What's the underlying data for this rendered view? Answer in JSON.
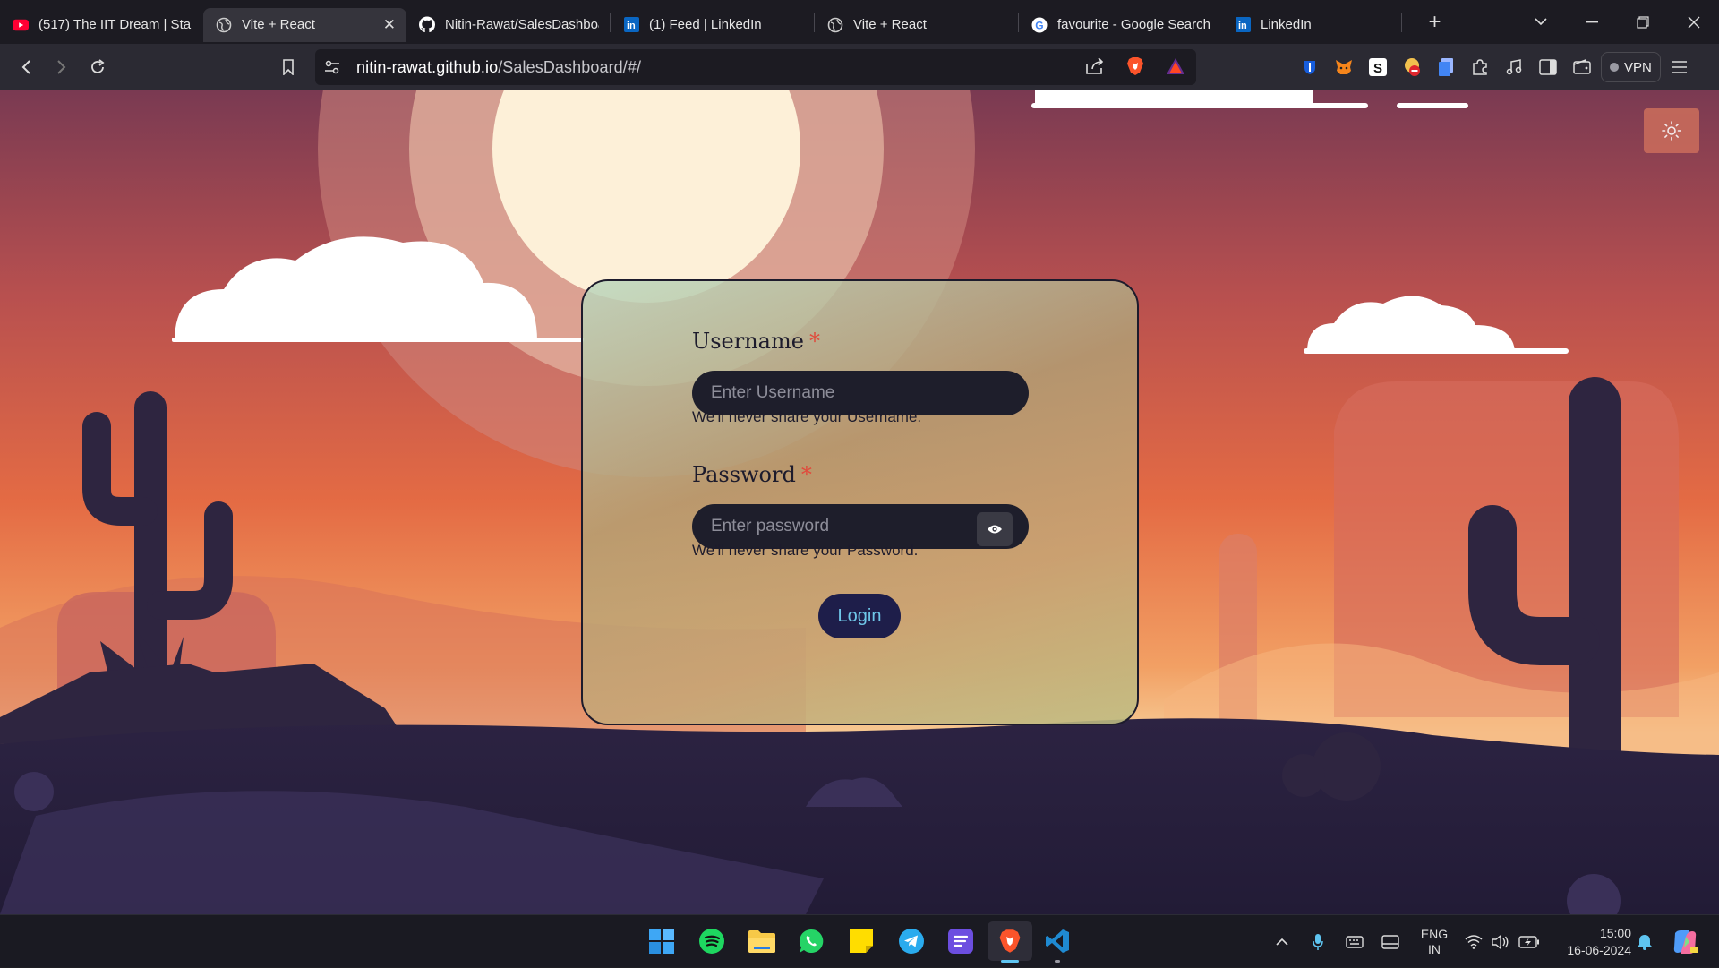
{
  "browser": {
    "tabs": [
      {
        "title": "(517) The IIT Dream | Stan",
        "favicon": "youtube-icon",
        "active": false
      },
      {
        "title": "Vite + React",
        "favicon": "globe-icon",
        "active": true
      },
      {
        "title": "Nitin-Rawat/SalesDashboa",
        "favicon": "github-icon",
        "active": false
      },
      {
        "title": "(1) Feed | LinkedIn",
        "favicon": "linkedin-icon",
        "active": false
      },
      {
        "title": "Vite + React",
        "favicon": "globe-icon",
        "active": false
      },
      {
        "title": "favourite - Google Search",
        "favicon": "google-icon",
        "active": false
      },
      {
        "title": "LinkedIn",
        "favicon": "linkedin-icon",
        "active": false
      }
    ],
    "close_glyph": "✕",
    "new_tab_glyph": "+",
    "url_host": "nitin-rawat.github.io",
    "url_path": "/SalesDashboard/#/",
    "vpn_label": "VPN"
  },
  "login": {
    "username_label": "Username",
    "username_required": "*",
    "username_placeholder": "Enter Username",
    "username_help": "We'll never share your Username.",
    "password_label": "Password",
    "password_required": "*",
    "password_placeholder": "Enter password",
    "password_help": "We'll never share your Password.",
    "login_label": "Login"
  },
  "taskbar": {
    "apps": [
      "start-icon",
      "spotify-icon",
      "file-explorer-icon",
      "whatsapp-icon",
      "sticky-notes-icon",
      "telegram-icon",
      "notes-app-icon",
      "brave-icon",
      "vscode-icon"
    ],
    "lang_top": "ENG",
    "lang_bottom": "IN",
    "time": "15:00",
    "date": "16-06-2024"
  },
  "colors": {
    "accent_login_text": "#6fc6e8",
    "required_star": "#e04a3c",
    "input_bg": "#1e1e2b"
  }
}
